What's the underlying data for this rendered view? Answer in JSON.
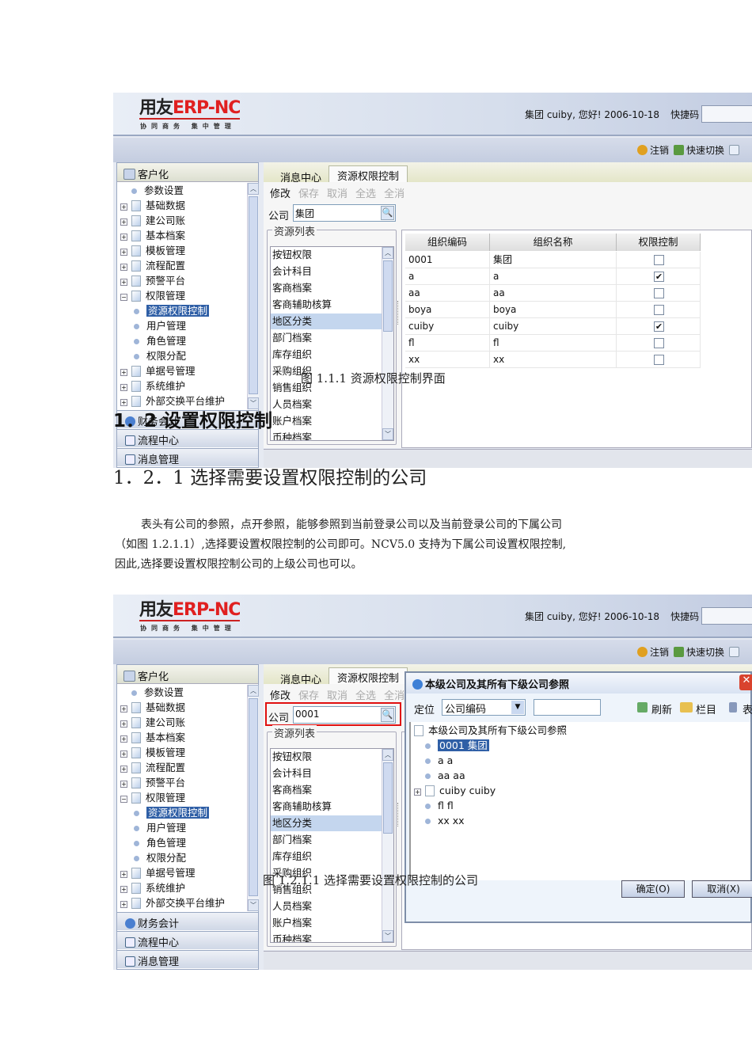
{
  "app": {
    "logo": {
      "brand_left": "用友",
      "brand_right": "ERP-NC",
      "subtitle": "协同商务   集中管理"
    },
    "greeting": "集团 cuiby, 您好! 2006-10-18",
    "quick_code_label": "快捷码",
    "toolbar": {
      "logout": "注销",
      "switch": "快速切换"
    },
    "left_header": "客户化",
    "tree": [
      {
        "label": "参数设置",
        "type": "leaf",
        "level": 0
      },
      {
        "label": "基础数据",
        "type": "folder",
        "level": 0
      },
      {
        "label": "建公司账",
        "type": "folder",
        "level": 0
      },
      {
        "label": "基本档案",
        "type": "folder",
        "level": 0
      },
      {
        "label": "模板管理",
        "type": "folder",
        "level": 0
      },
      {
        "label": "流程配置",
        "type": "folder",
        "level": 0
      },
      {
        "label": "预警平台",
        "type": "folder",
        "level": 0
      },
      {
        "label": "权限管理",
        "type": "open",
        "level": 0
      },
      {
        "label": "资源权限控制",
        "type": "leaf",
        "level": 1,
        "selected": true
      },
      {
        "label": "用户管理",
        "type": "leaf",
        "level": 1
      },
      {
        "label": "角色管理",
        "type": "leaf",
        "level": 1
      },
      {
        "label": "权限分配",
        "type": "leaf",
        "level": 1
      },
      {
        "label": "单据号管理",
        "type": "folder",
        "level": 0
      },
      {
        "label": "系统维护",
        "type": "folder",
        "level": 0
      },
      {
        "label": "外部交换平台维护",
        "type": "folder",
        "level": 0
      }
    ],
    "accordion": [
      "财务会计",
      "流程中心",
      "消息管理"
    ],
    "tabs": [
      "消息中心",
      "资源权限控制"
    ],
    "actions": [
      {
        "label": "修改",
        "enabled": true
      },
      {
        "label": "保存",
        "enabled": false
      },
      {
        "label": "取消",
        "enabled": false
      },
      {
        "label": "全选",
        "enabled": false
      },
      {
        "label": "全消",
        "enabled": false
      }
    ],
    "company_label": "公司",
    "resource_list_label": "资源列表",
    "resources": [
      "按钮权限",
      "会计科目",
      "客商档案",
      "客商辅助核算",
      "地区分类",
      "部门档案",
      "库存组织",
      "采购组织",
      "销售组织",
      "人员档案",
      "账户档案",
      "币种档案"
    ],
    "selected_resource": "地区分类",
    "table": {
      "columns": [
        "组织编码",
        "组织名称",
        "权限控制"
      ],
      "rows": [
        {
          "code": "0001",
          "name": "集团",
          "checked": false
        },
        {
          "code": "a",
          "name": "a",
          "checked": true
        },
        {
          "code": "aa",
          "name": "aa",
          "checked": false
        },
        {
          "code": "boya",
          "name": "boya",
          "checked": false
        },
        {
          "code": "cuiby",
          "name": "cuiby",
          "checked": true
        },
        {
          "code": "fl",
          "name": "fl",
          "checked": false
        },
        {
          "code": "xx",
          "name": "xx",
          "checked": false
        }
      ]
    }
  },
  "screenshot1": {
    "company_value": "集团"
  },
  "screenshot2": {
    "company_value": "0001",
    "dialog": {
      "title": "本级公司及其所有下级公司参照",
      "locate_label": "定位",
      "locate_option": "公司编码",
      "refresh": "刷新",
      "columns": "栏目",
      "table_btn": "表",
      "root": "本级公司及其所有下级公司参照",
      "nodes": [
        {
          "label": "0001 集团",
          "selected": true,
          "folder": false
        },
        {
          "label": "a a",
          "folder": false
        },
        {
          "label": "aa aa",
          "folder": false
        },
        {
          "label": "cuiby cuiby",
          "folder": true
        },
        {
          "label": "fl fl",
          "folder": false
        },
        {
          "label": "xx xx",
          "folder": false
        }
      ],
      "ok": "确定(O)",
      "cancel": "取消(X)"
    }
  },
  "doc": {
    "caption1": "图 1.1.1 资源权限控制界面",
    "heading_1_2": "1．2 设置权限控制",
    "heading_1_2_1": "1．2．1 选择需要设置权限控制的公司",
    "paragraph": [
      "表头有公司的参照，点开参照，能够参照到当前登录公司以及当前登录公司的下属公司",
      "（如图 1.2.1.1）,选择要设置权限控制的公司即可。NCV5.0 支持为下属公司设置权限控制,",
      "因此,选择要设置权限控制公司的上级公司也可以。"
    ],
    "caption2": "图 1.2.1.1 选择需要设置权限控制的公司"
  }
}
